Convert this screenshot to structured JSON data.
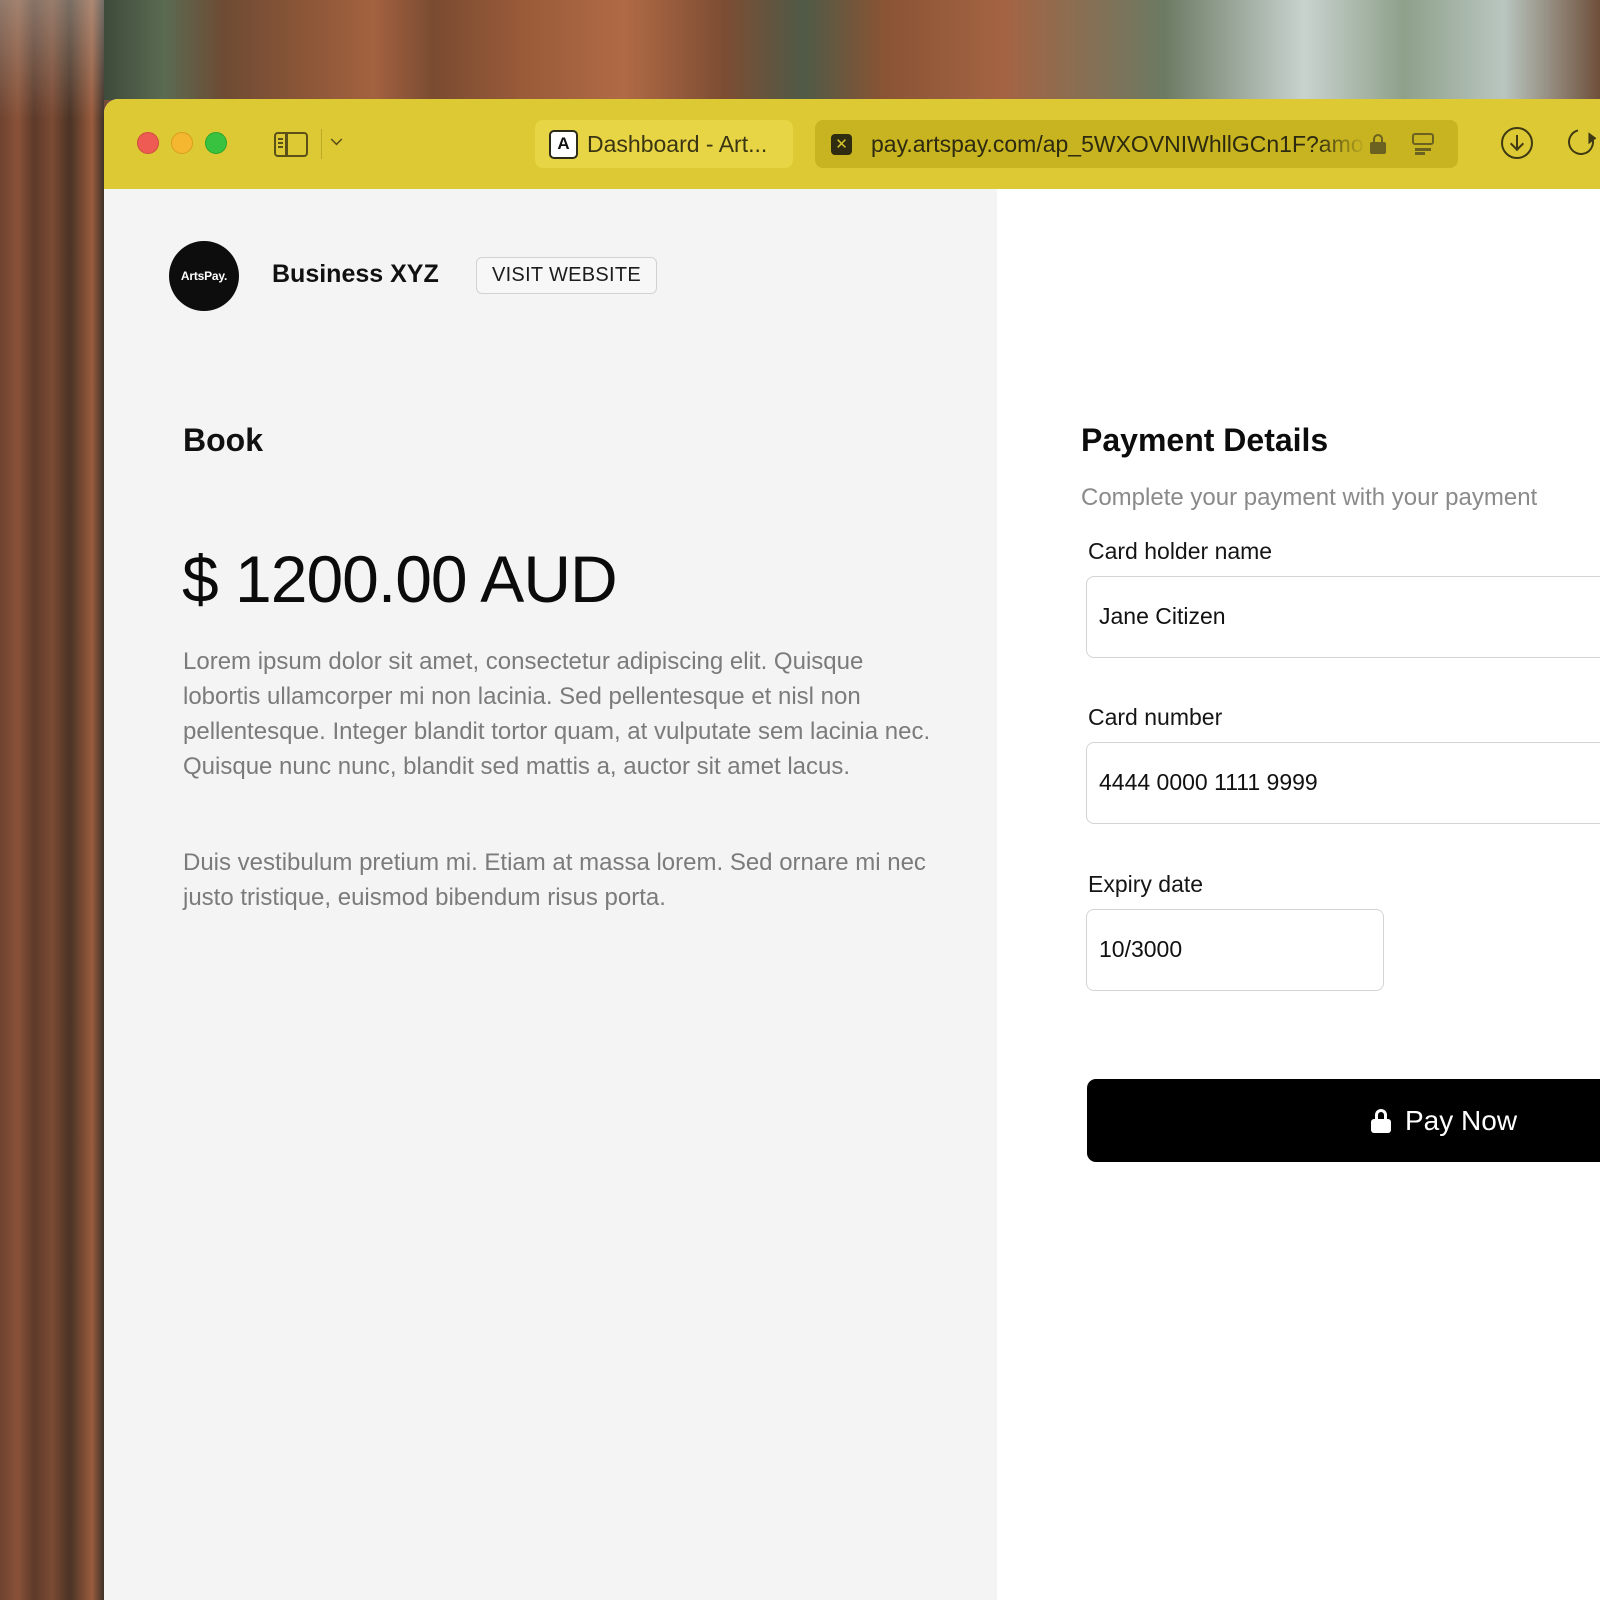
{
  "browser": {
    "tab_title": "Dashboard - Art...",
    "tab_favicon_letter": "A",
    "url": "pay.artspay.com/ap_5WXOVNIWhllGCn1F?amo",
    "url_favicon_glyph": "✕",
    "accent_color": "#dcc933"
  },
  "merchant": {
    "logo_text": "ArtsPay.",
    "business_name": "Business XYZ",
    "visit_website_label": "VISIT WEBSITE"
  },
  "product": {
    "title": "Book",
    "price": "$ 1200.00 AUD",
    "description_1": "Lorem ipsum dolor sit amet, consectetur adipiscing elit. Quisque lobortis ullamcorper mi non lacinia. Sed pellentesque et nisl non pellentesque. Integer blandit tortor quam, at vulputate sem lacinia nec. Quisque nunc nunc, blandit sed mattis a, auctor sit amet lacus.",
    "description_2": "Duis vestibulum pretium mi. Etiam at massa lorem. Sed ornare mi nec justo tristique, euismod bibendum risus porta."
  },
  "payment": {
    "heading": "Payment Details",
    "subtitle": "Complete your payment with your payment",
    "card_holder_label": "Card holder name",
    "card_holder_value": "Jane Citizen",
    "card_number_label": "Card number",
    "card_number_value": "4444 0000 1111 9999",
    "expiry_label": "Expiry date",
    "expiry_value": "10/3000",
    "pay_button_label": "Pay Now"
  }
}
